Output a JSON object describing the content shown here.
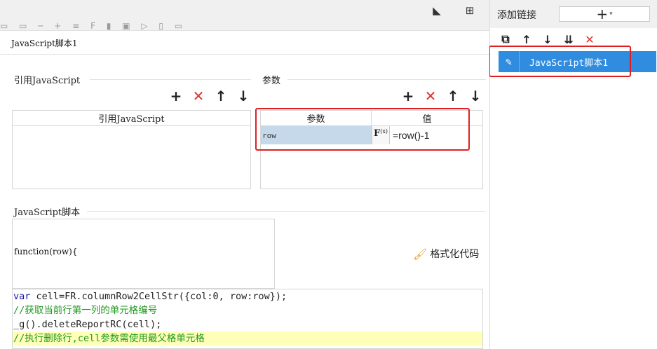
{
  "right_panel": {
    "title": "添加链接",
    "add_symbol": "+",
    "add_caret": "▾",
    "tools": [
      {
        "icon": "copy-icon",
        "glyph": "⧉"
      },
      {
        "icon": "arrow-up-icon",
        "glyph": "↑"
      },
      {
        "icon": "arrow-down-icon",
        "glyph": "↓"
      },
      {
        "icon": "move-bottom-icon",
        "glyph": "⇊"
      },
      {
        "icon": "delete-icon",
        "glyph": "✕"
      }
    ],
    "links": [
      {
        "label": "JavaScript脚本1",
        "icon": "pencil-icon",
        "glyph": "✎",
        "selected": true
      }
    ]
  },
  "top_icons": {
    "corner_glyph": "◣",
    "layout_glyph": "⊞"
  },
  "editor": {
    "script_name": "JavaScript脚本1",
    "ref_section": {
      "title": "引用JavaScript",
      "column_header": "引用JavaScript",
      "controls": [
        {
          "icon": "add-icon",
          "glyph": "+"
        },
        {
          "icon": "remove-icon",
          "glyph": "✕"
        },
        {
          "icon": "arrow-up-icon",
          "glyph": "↑"
        },
        {
          "icon": "arrow-down-icon",
          "glyph": "↓"
        }
      ]
    },
    "param_section": {
      "title": "参数",
      "headers": [
        "参数",
        "值"
      ],
      "rows": [
        {
          "name": "row",
          "fx": "F",
          "fx_sub": "(x)",
          "value": "=row()-1"
        }
      ],
      "controls": [
        {
          "icon": "add-icon",
          "glyph": "+"
        },
        {
          "icon": "remove-icon",
          "glyph": "✕"
        },
        {
          "icon": "arrow-up-icon",
          "glyph": "↑"
        },
        {
          "icon": "arrow-down-icon",
          "glyph": "↓"
        }
      ]
    },
    "script_section": {
      "title": "JavaScript脚本",
      "function_signature": "function(row){",
      "format_button": "格式化代码",
      "code_lines": [
        "var cell=FR.columnRow2CellStr({col:0, row:row});",
        "//获取当前行第一列的单元格编号",
        "_g().deleteReportRC(cell);",
        "//执行删除行,cell参数需使用最父格单元格"
      ]
    }
  },
  "colors": {
    "accent": "#2f8cde",
    "highlight_box": "#e02020",
    "delete_red": "#e0332b",
    "param_cell": "#c5d9ea",
    "code_highlight": "#ffffb8"
  }
}
